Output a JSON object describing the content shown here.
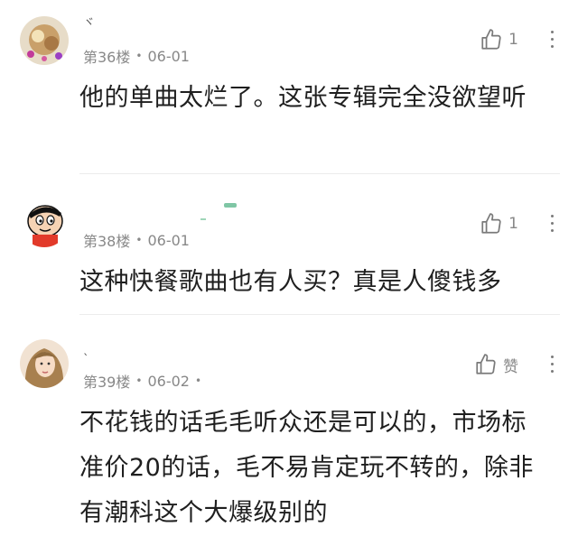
{
  "comments": [
    {
      "username": "ヾ",
      "floor": "第36楼",
      "date": "06-01",
      "likes": "1",
      "text": "他的单曲太烂了。这张专辑完全没欲望听"
    },
    {
      "username": "",
      "floor": "第38楼",
      "date": "06-01",
      "likes": "1",
      "text": "这种快餐歌曲也有人买？真是人傻钱多"
    },
    {
      "username": "ˎ",
      "floor": "第39楼",
      "date": "06-02",
      "likes": "赞",
      "text": "不花钱的话毛毛听众还是可以的，市场标准价20的话，毛不易肯定玩不转的，除非有潮科这个大爆级别的"
    }
  ],
  "separator": "•",
  "icons": {
    "like": "thumbs-up-icon",
    "more": "more-vertical-icon"
  },
  "colors": {
    "meta": "#888888",
    "text": "#1f1f1f",
    "divider": "#ececec"
  }
}
